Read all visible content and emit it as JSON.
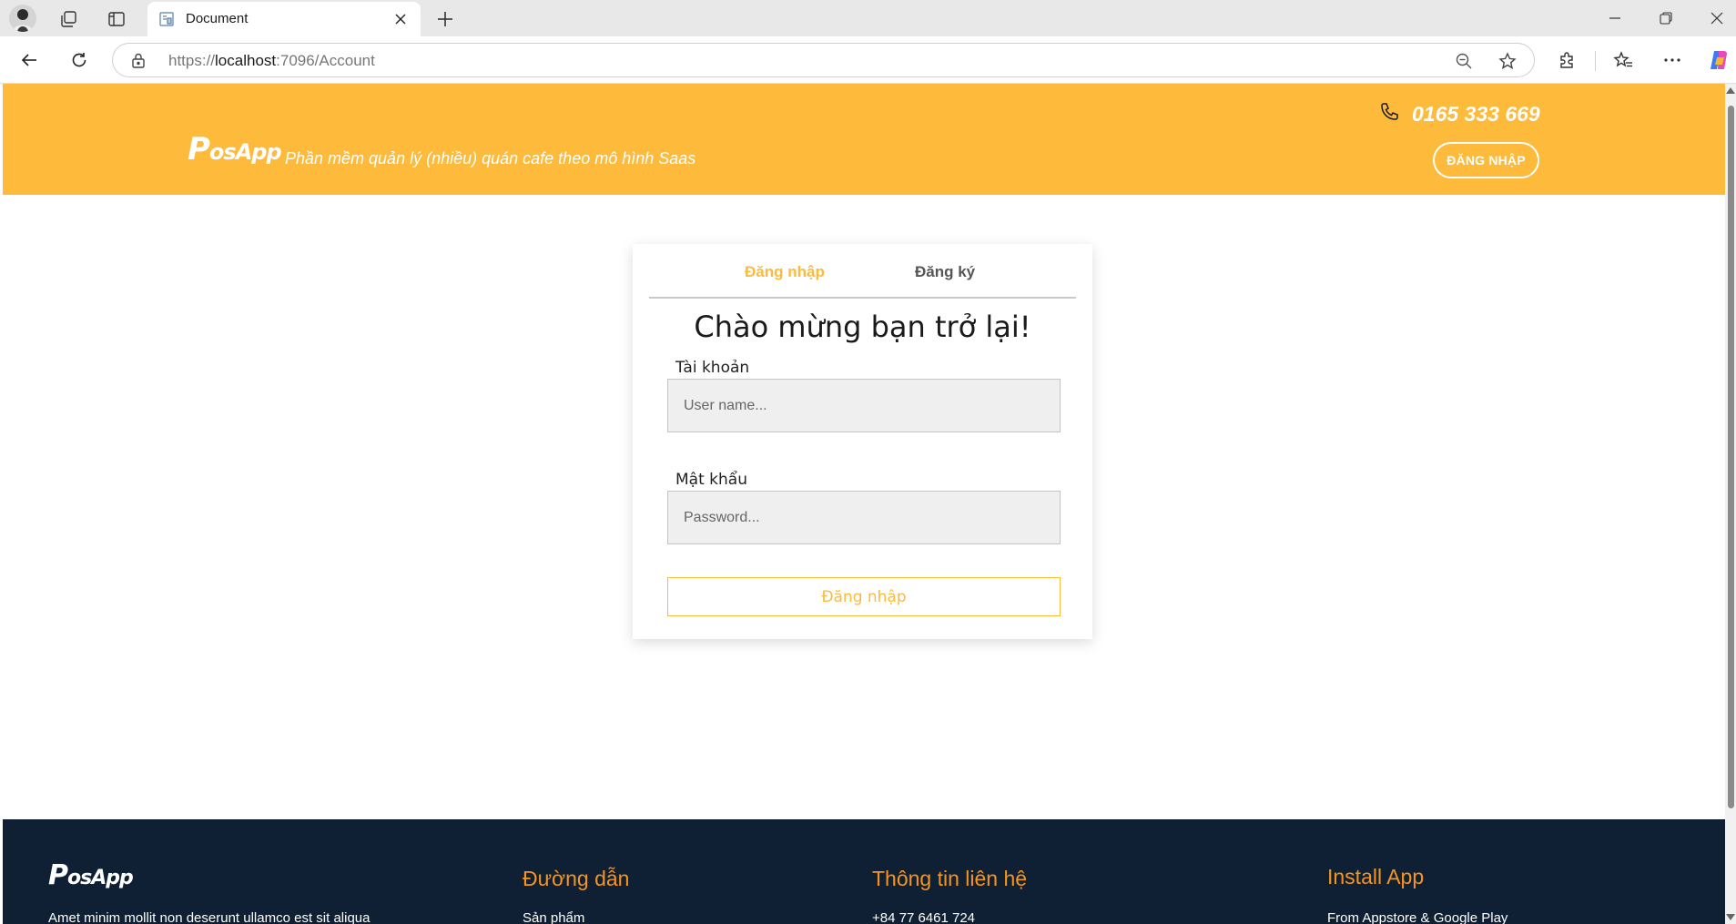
{
  "browser": {
    "tab_title": "Document",
    "url_prefix": "https://",
    "url_host": "localhost",
    "url_path": ":7096/Account"
  },
  "header": {
    "logo_main": "P",
    "logo_rest": "osApp",
    "tagline": "Phần mềm quản lý (nhiều) quán cafe theo mô hình Saas",
    "phone": "0165 333 669",
    "login_button": "ĐĂNG NHẬP"
  },
  "login_card": {
    "tabs": [
      {
        "label": "Đăng nhập",
        "active": true
      },
      {
        "label": "Đăng ký",
        "active": false
      }
    ],
    "title": "Chào mừng bạn trở lại!",
    "username_label": "Tài khoản",
    "username_placeholder": "User name...",
    "password_label": "Mật khẩu",
    "password_placeholder": "Password...",
    "submit_label": "Đăng nhập"
  },
  "footer": {
    "logo_main": "P",
    "logo_rest": "osApp",
    "description": "Amet minim mollit non deserunt ullamco est sit aliqua",
    "columns": [
      {
        "heading": "Đường dẫn",
        "first_item": "Sản phẩm"
      },
      {
        "heading": "Thông tin liên hệ",
        "first_item": "+84 77 6461 724"
      },
      {
        "heading": "Install App",
        "first_item": "From Appstore & Google Play"
      }
    ]
  },
  "colors": {
    "brand": "#fdba3b",
    "footer_bg": "#0f2035",
    "footer_heading": "#f7941d"
  }
}
